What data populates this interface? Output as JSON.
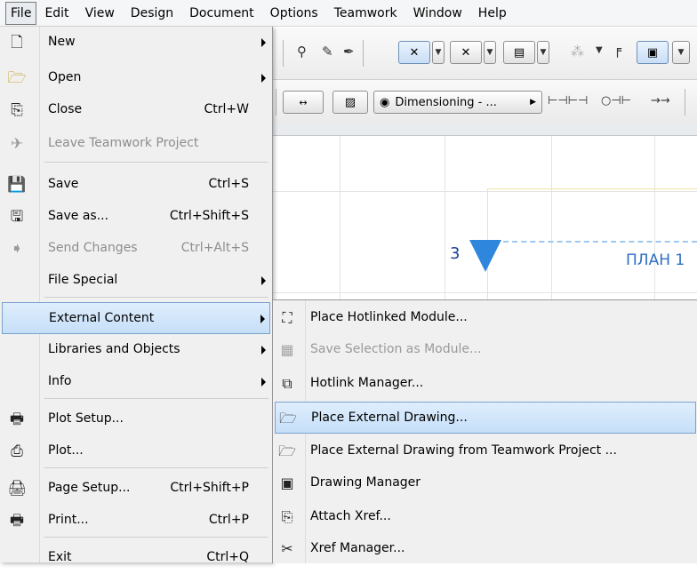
{
  "menubar": {
    "items": [
      "File",
      "Edit",
      "View",
      "Design",
      "Document",
      "Options",
      "Teamwork",
      "Window",
      "Help"
    ]
  },
  "toolbar": {
    "dimensioning_label": "Dimensioning - ..."
  },
  "canvas": {
    "marker_number": "3",
    "plan_label": "ПЛАН 1"
  },
  "file_menu": {
    "items": [
      {
        "label": "New",
        "shortcut": "",
        "submenu": true,
        "icon": "new-document-icon"
      },
      {
        "label": "Open",
        "shortcut": "",
        "submenu": true,
        "icon": "open-folder-icon"
      },
      {
        "label": "Close",
        "shortcut": "Ctrl+W",
        "icon": "close-document-icon"
      },
      {
        "label": "Leave Teamwork Project",
        "shortcut": "",
        "disabled": true,
        "icon": "teamwork-leave-icon"
      },
      {
        "label": "Save",
        "shortcut": "Ctrl+S",
        "icon": "save-disk-icon"
      },
      {
        "label": "Save as...",
        "shortcut": "Ctrl+Shift+S",
        "icon": "save-as-icon"
      },
      {
        "label": "Send Changes",
        "shortcut": "Ctrl+Alt+S",
        "disabled": true,
        "icon": "send-changes-icon"
      },
      {
        "label": "File Special",
        "shortcut": "",
        "submenu": true
      },
      {
        "label": "External Content",
        "shortcut": "",
        "submenu": true,
        "highlighted": true
      },
      {
        "label": "Libraries and Objects",
        "shortcut": "",
        "submenu": true
      },
      {
        "label": "Info",
        "shortcut": "",
        "submenu": true
      },
      {
        "label": "Plot Setup...",
        "shortcut": "",
        "icon": "plot-setup-icon"
      },
      {
        "label": "Plot...",
        "shortcut": "",
        "icon": "plotter-icon"
      },
      {
        "label": "Page Setup...",
        "shortcut": "Ctrl+Shift+P",
        "icon": "page-setup-icon"
      },
      {
        "label": "Print...",
        "shortcut": "Ctrl+P",
        "icon": "printer-icon"
      },
      {
        "label": "Exit",
        "shortcut": "Ctrl+Q"
      }
    ]
  },
  "submenu": {
    "items": [
      {
        "label": "Place Hotlinked Module...",
        "icon": "hotlinked-module-icon"
      },
      {
        "label": "Save Selection as Module...",
        "disabled": true,
        "icon": "save-module-icon"
      },
      {
        "label": "Hotlink Manager...",
        "icon": "hotlink-manager-icon"
      },
      {
        "label": "Place External Drawing...",
        "highlighted": true,
        "icon": "external-drawing-icon"
      },
      {
        "label": "Place External Drawing from Teamwork Project ...",
        "icon": "teamwork-drawing-icon"
      },
      {
        "label": "Drawing Manager",
        "icon": "drawing-manager-icon"
      },
      {
        "label": "Attach Xref...",
        "icon": "attach-xref-icon"
      },
      {
        "label": "Xref Manager...",
        "icon": "xref-manager-icon"
      }
    ]
  },
  "colors": {
    "highlight": "#c6dff8",
    "highlight_border": "#7da2ce",
    "marker_blue": "#2e87dd"
  }
}
